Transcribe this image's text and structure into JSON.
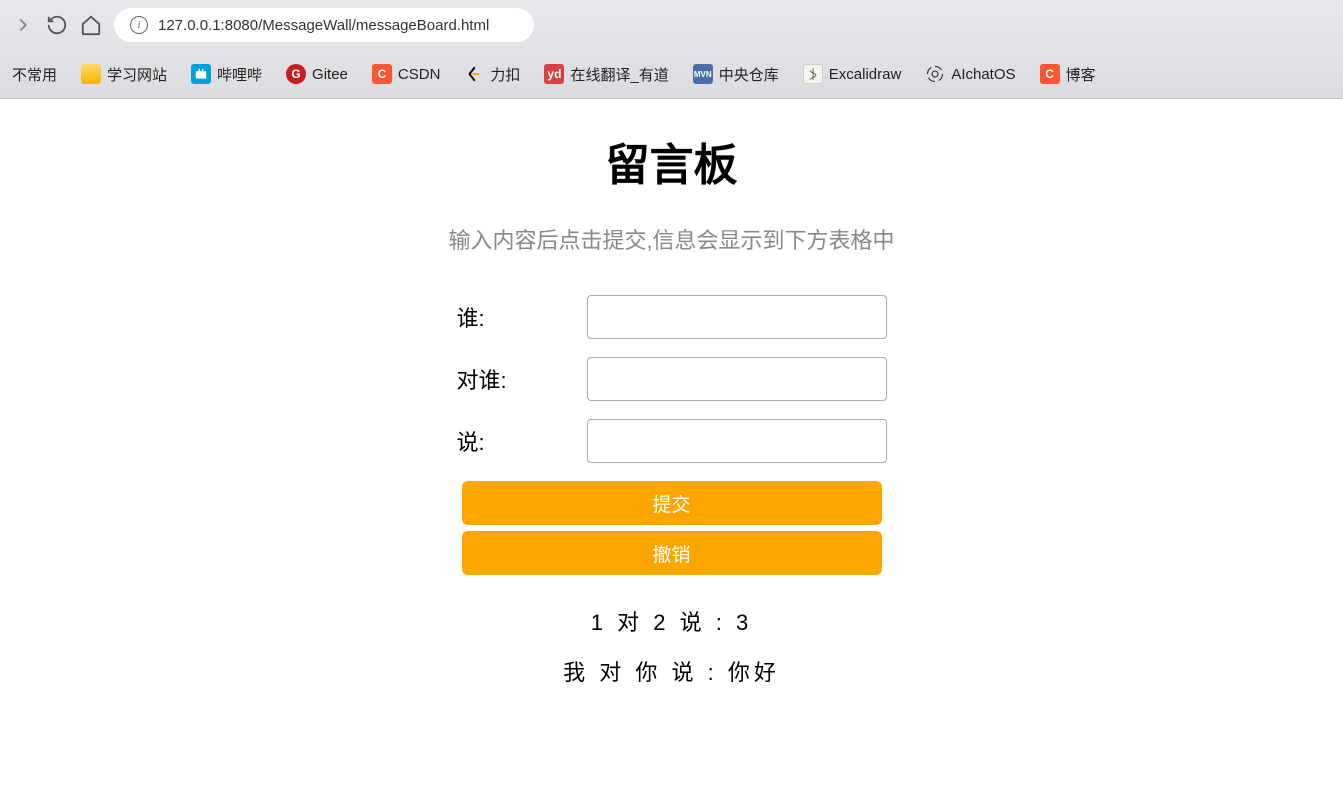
{
  "browser": {
    "url": "127.0.0.1:8080/MessageWall/messageBoard.html",
    "bookmarks": [
      {
        "label": "不常用",
        "icon": ""
      },
      {
        "label": "学习网站",
        "icon": "folder"
      },
      {
        "label": "哔哩哔",
        "icon": "bili"
      },
      {
        "label": "Gitee",
        "icon": "gitee"
      },
      {
        "label": "CSDN",
        "icon": "csdn"
      },
      {
        "label": "力扣",
        "icon": "leetcode"
      },
      {
        "label": "在线翻译_有道",
        "icon": "youdao"
      },
      {
        "label": "中央仓库",
        "icon": "maven"
      },
      {
        "label": "Excalidraw",
        "icon": "excalidraw"
      },
      {
        "label": "AIchatOS",
        "icon": "aichatos"
      },
      {
        "label": "博客",
        "icon": "blog"
      }
    ]
  },
  "page": {
    "title": "留言板",
    "subtitle": "输入内容后点击提交,信息会显示到下方表格中",
    "form": {
      "who_label": "谁:",
      "to_who_label": "对谁:",
      "say_label": "说:",
      "who_value": "",
      "to_who_value": "",
      "say_value": "",
      "submit_label": "提交",
      "undo_label": "撤销"
    },
    "messages": [
      "1 对 2 说 : 3",
      "我 对 你 说 : 你好"
    ]
  }
}
